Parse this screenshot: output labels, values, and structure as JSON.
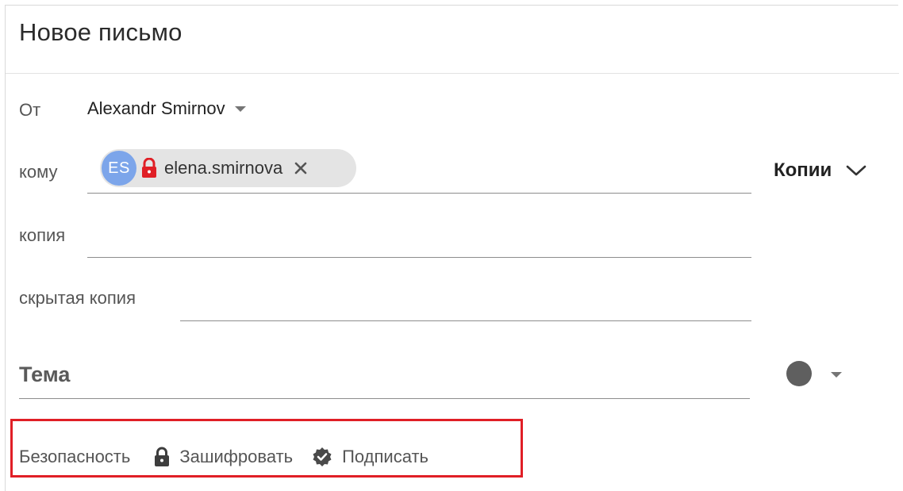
{
  "compose": {
    "title": "Новое письмо",
    "from_label": "От",
    "from_value": "Alexandr Smirnov",
    "to_label": "кому",
    "recipient": {
      "initials": "ES",
      "name": "elena.smirnova"
    },
    "cc_label": "копия",
    "bcc_label": "скрытая копия",
    "copies_label": "Копии",
    "subject_placeholder": "Тема"
  },
  "security": {
    "label": "Безопасность",
    "encrypt_label": "Зашифровать",
    "sign_label": "Подписать"
  },
  "colors": {
    "avatar": "#7ca5ea",
    "lock": "#e01f26",
    "highlight": "#e01f26",
    "label_dot": "#5f5f5f"
  }
}
